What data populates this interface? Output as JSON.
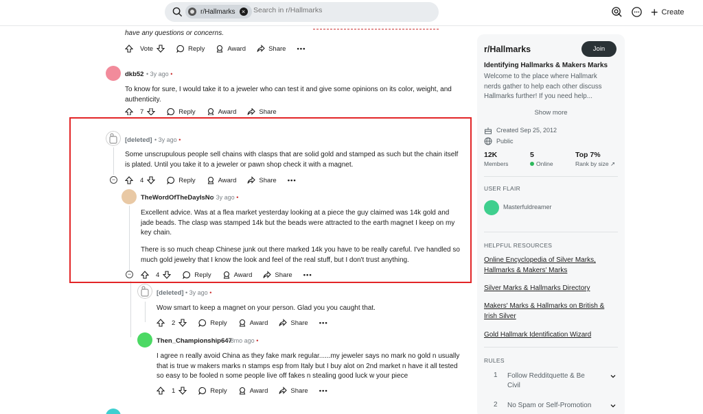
{
  "header": {
    "community_chip": "r/Hallmarks",
    "search_placeholder": "Search in r/Hallmarks",
    "create_label": "Create"
  },
  "top_comment_tail": {
    "text": "have any questions or concerns.",
    "actions": {
      "vote": "Vote",
      "reply": "Reply",
      "award": "Award",
      "share": "Share",
      "more": "•••"
    }
  },
  "comments": [
    {
      "author": "dkb52",
      "age": "3y ago",
      "text": "To know for sure, I would take it to a jeweler who can test it and give some opinions on its color, weight, and authenticity.",
      "votes": "7",
      "reply": "Reply",
      "award": "Award",
      "share": "Share"
    },
    {
      "author": "[deleted]",
      "age": "3y ago",
      "text": "Some unscrupulous people sell chains with clasps that are solid gold and stamped as such but the chain itself is plated. Until you take it to a jeweler or pawn shop check it with a magnet.",
      "votes": "4",
      "reply": "Reply",
      "award": "Award",
      "share": "Share",
      "more": "•••"
    },
    {
      "author": "TheWordOfTheDayIsNo",
      "age": "3y ago",
      "text1": "Excellent advice. Was at a flea market yesterday looking at a piece the guy claimed was 14k gold and jade beads. The clasp was stamped 14k but the beads were attracted to the earth magnet I keep on my key chain.",
      "text2": "There is so much cheap Chinese junk out there marked 14k you have to be really careful. I've handled so much gold jewelry that I know the look and feel of the real stuff, but I don't trust anything.",
      "votes": "4",
      "reply": "Reply",
      "award": "Award",
      "share": "Share",
      "more": "•••"
    },
    {
      "author": "[deleted]",
      "age": "3y ago",
      "text": "Wow smart to keep a magnet on your person. Glad you you caught that.",
      "votes": "2",
      "reply": "Reply",
      "award": "Award",
      "share": "Share",
      "more": "•••"
    },
    {
      "author": "Then_Championship647",
      "age": "8mo ago",
      "text": "I agree n really avoid China as they fake mark regular......my jeweler says no mark no gold n usually that is true w makers marks n stamps esp from Italy but I buy alot on 2nd market n have it all tested so easy to be fooled n some people live off fakes n stealing good luck w your piece",
      "votes": "1",
      "reply": "Reply",
      "award": "Award",
      "share": "Share",
      "more": "•••"
    }
  ],
  "sidebar": {
    "title": "r/Hallmarks",
    "join": "Join",
    "headline": "Identifying Hallmarks & Makers Marks",
    "description": "Welcome to the place where Hallmark nerds gather to help each other discuss Hallmarks further! If you need help...",
    "show_more": "Show more",
    "created": "Created Sep 25, 2012",
    "visibility": "Public",
    "members_value": "12K",
    "members_label": "Members",
    "online_value": "5",
    "online_label": "Online",
    "rank_value": "Top 7%",
    "rank_label": "Rank by size",
    "user_flair_heading": "USER FLAIR",
    "flair_name": "Masterfuldreamer",
    "resources_heading": "HELPFUL RESOURCES",
    "resources": [
      "Online Encyclopedia of Silver Marks, Hallmarks & Makers' Marks",
      "Silver Marks & Hallmarks Directory",
      "Makers' Marks & Hallmarks on British & Irish Silver",
      "Gold Hallmark Identification Wizard"
    ],
    "rules_heading": "RULES",
    "rules": [
      {
        "num": "1",
        "text": "Follow Redditquette & Be Civil"
      },
      {
        "num": "2",
        "text": "No Spam or Self-Promotion"
      }
    ]
  },
  "colors": {
    "highlight_box": "#e22426",
    "join_bg": "#2a3236",
    "online_dot": "#2eb85c"
  }
}
